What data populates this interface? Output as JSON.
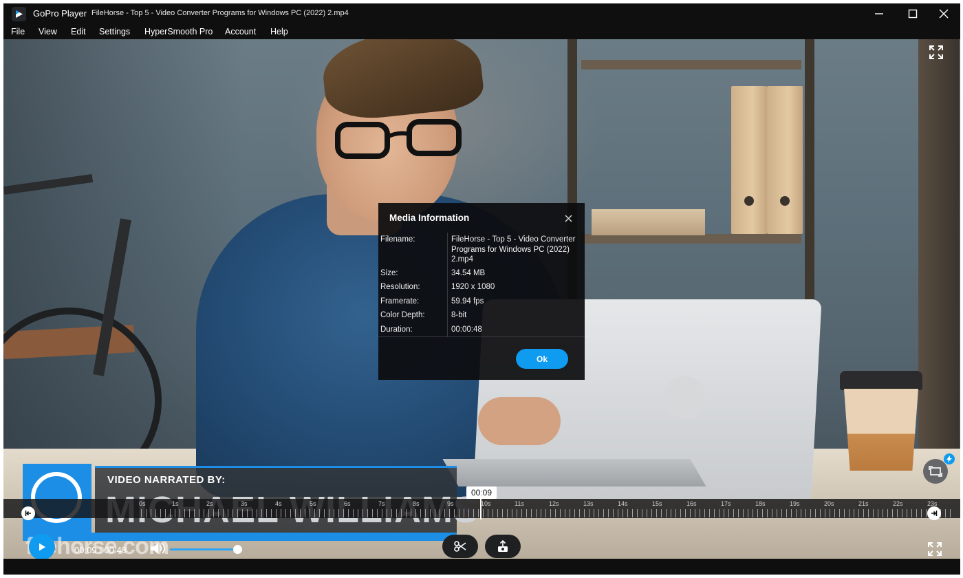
{
  "app": {
    "name": "GoPro Player",
    "document_title": "FileHorse - Top 5 - Video Converter Programs for Windows PC (2022) 2.mp4"
  },
  "window_controls": [
    "minimize-icon",
    "maximize-icon",
    "close-icon"
  ],
  "menu": [
    "File",
    "View",
    "Edit",
    "Settings",
    "HyperSmooth Pro",
    "Account",
    "Help"
  ],
  "video_overlay": {
    "lower_third_label": "VIDEO NARRATED BY:",
    "lower_third_name": "MICHAEL WILLIAMS",
    "watermark": "filehorse.com"
  },
  "dialog": {
    "title": "Media Information",
    "rows": [
      {
        "label": "Filename:",
        "value": "FileHorse - Top 5 - Video Converter Programs for Windows PC (2022) 2.mp4"
      },
      {
        "label": "Size:",
        "value": "34.54 MB"
      },
      {
        "label": "Resolution:",
        "value": "1920 x 1080"
      },
      {
        "label": "Framerate:",
        "value": "59.94 fps"
      },
      {
        "label": "Color Depth:",
        "value": "8-bit"
      },
      {
        "label": "Duration:",
        "value": "00:00:48"
      }
    ],
    "ok_label": "Ok"
  },
  "timeline": {
    "ticks": [
      "0s",
      "1s",
      "2s",
      "3s",
      "4s",
      "5s",
      "6s",
      "7s",
      "8s",
      "9s",
      "10s",
      "11s",
      "12s",
      "13s",
      "14s",
      "15s",
      "16s",
      "17s",
      "18s",
      "19s",
      "20s",
      "21s",
      "22s",
      "23s"
    ],
    "playhead_label": "00:09"
  },
  "controls": {
    "time": "00:09 / 00:48",
    "volume_level": 0.98,
    "accent_color": "#0f9bf0"
  }
}
